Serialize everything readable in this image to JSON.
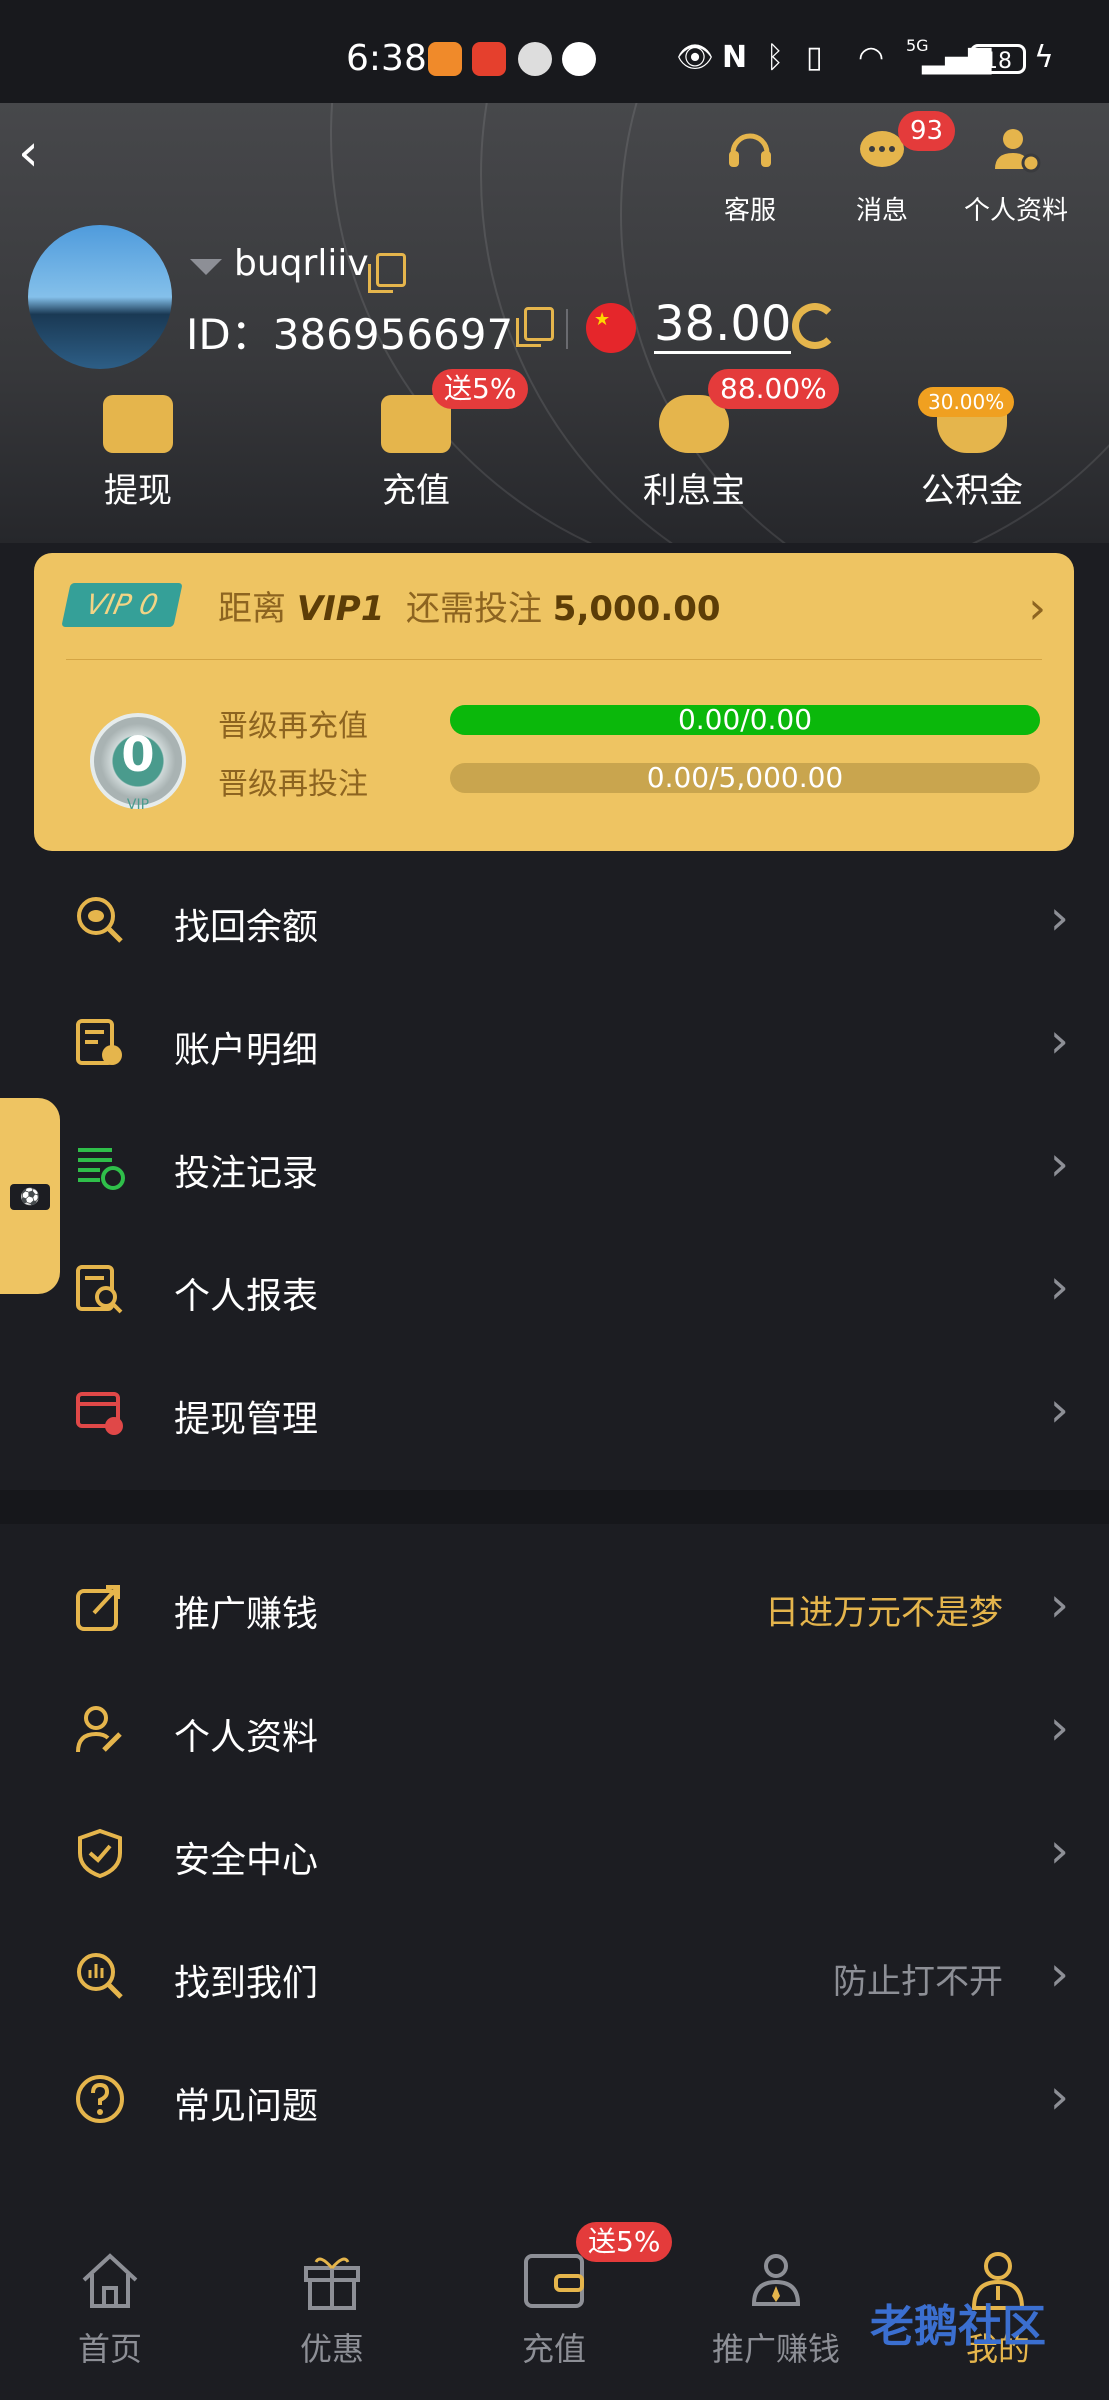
{
  "status_bar": {
    "time": "6:38",
    "network": "5G",
    "battery": "18"
  },
  "header": {
    "actions": [
      {
        "label": "客服",
        "icon": "headset-icon"
      },
      {
        "label": "消息",
        "icon": "message-icon",
        "badge": "93"
      },
      {
        "label": "个人资料",
        "icon": "profile-settings-icon"
      }
    ],
    "username": "buqrliiv",
    "id_text": "ID：386956697",
    "balance": "38.00"
  },
  "quick_actions": [
    {
      "label": "提现",
      "icon": "withdraw-icon"
    },
    {
      "label": "充值",
      "icon": "wallet-icon",
      "badge": "送5%"
    },
    {
      "label": "利息宝",
      "icon": "piggy-bank-icon",
      "badge": "88.00%"
    },
    {
      "label": "公积金",
      "icon": "hands-coin-icon",
      "badge": "30.00%"
    }
  ],
  "vip": {
    "tag": "VIP 0",
    "prefix": "距离",
    "next_level": "VIP1",
    "need_text": "还需投注",
    "need_amount": "5,000.00",
    "level": "0",
    "medal_text": "VIP",
    "recharge_label": "晋级再充值",
    "recharge_progress": "0.00/0.00",
    "recharge_fill": 1.0,
    "bet_label": "晋级再投注",
    "bet_progress": "0.00/5,000.00",
    "bet_fill": 0.0
  },
  "menu_group1": [
    {
      "label": "找回余额",
      "icon": "search-coin-icon",
      "color": "#e5b54c"
    },
    {
      "label": "账户明细",
      "icon": "account-detail-icon",
      "color": "#e5b54c"
    },
    {
      "label": "投注记录",
      "icon": "bet-record-icon",
      "color": "#2fbf4a"
    },
    {
      "label": "个人报表",
      "icon": "report-search-icon",
      "color": "#e5b54c"
    },
    {
      "label": "提现管理",
      "icon": "withdraw-manage-icon",
      "color": "#e04848"
    }
  ],
  "menu_group2": [
    {
      "label": "推广赚钱",
      "icon": "share-icon",
      "right": "日进万元不是梦",
      "right_color": "#e5b54c"
    },
    {
      "label": "个人资料",
      "icon": "user-edit-icon",
      "right": ""
    },
    {
      "label": "安全中心",
      "icon": "shield-check-icon",
      "right": ""
    },
    {
      "label": "找到我们",
      "icon": "find-us-icon",
      "right": "防止打不开",
      "right_color": "#8d8f96"
    },
    {
      "label": "常见问题",
      "icon": "question-icon",
      "right": ""
    }
  ],
  "tabbar": [
    {
      "label": "首页",
      "icon": "home-icon"
    },
    {
      "label": "优惠",
      "icon": "gift-icon"
    },
    {
      "label": "充值",
      "icon": "wallet-icon",
      "badge": "送5%"
    },
    {
      "label": "推广赚钱",
      "icon": "people-icon"
    },
    {
      "label": "我的",
      "icon": "user-icon",
      "active": true
    }
  ],
  "watermark": "老鹅社区",
  "colors": {
    "accent": "#e5b54c",
    "badge_red": "#e43b3b",
    "progress_green": "#0bb80b"
  }
}
